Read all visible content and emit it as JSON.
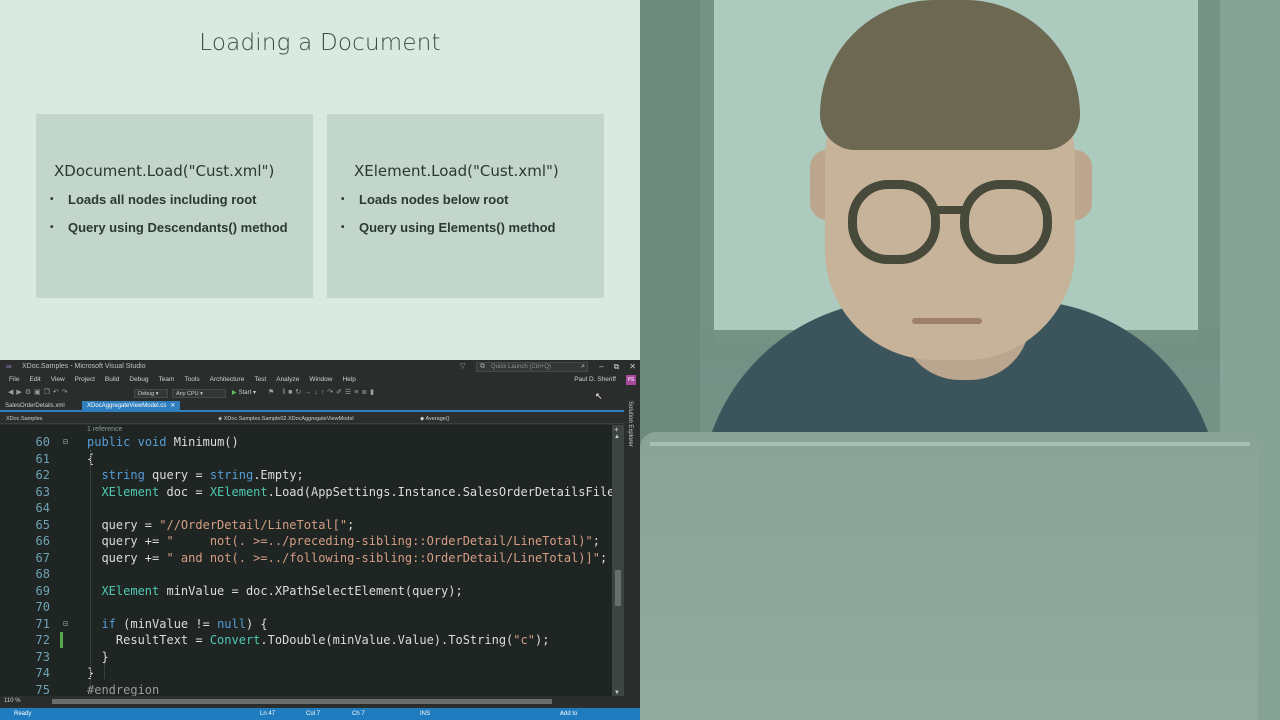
{
  "slide": {
    "title": "Loading a Document",
    "cards": [
      {
        "heading": "XDocument.Load(\"Cust.xml\")",
        "bullets": [
          "Loads all nodes including root",
          "Query using Descendants() method"
        ]
      },
      {
        "heading": "XElement.Load(\"Cust.xml\")",
        "bullets": [
          "Loads nodes below root",
          "Query using Elements() method"
        ]
      }
    ]
  },
  "ide": {
    "window_title": "XDoc.Samples - Microsoft Visual Studio",
    "quick_launch_placeholder": "Quick Launch (Ctrl+Q)",
    "menu": [
      "File",
      "Edit",
      "View",
      "Project",
      "Build",
      "Debug",
      "Team",
      "Tools",
      "Architecture",
      "Test",
      "Analyze",
      "Window",
      "Help"
    ],
    "user_name": "Paul D. Sheriff",
    "user_initials": "PS",
    "toolbar": {
      "config": "Debug",
      "platform": "Any CPU",
      "start_label": "Start"
    },
    "tabs": [
      {
        "label": "SalesOrderDetails.xml",
        "active": false
      },
      {
        "label": "XDocAggregateViewModel.cs",
        "active": true
      }
    ],
    "navbar": {
      "project": "XDoc.Samples",
      "class": "XDoc.Samples.Sample02.XDocAggregateViewModel",
      "member": "Average()"
    },
    "reference_note": "1 reference",
    "code_lines": [
      {
        "num": "60",
        "text": "public void Minimum()"
      },
      {
        "num": "61",
        "text": "{"
      },
      {
        "num": "62",
        "text": "  string query = string.Empty;"
      },
      {
        "num": "63",
        "text": "  XElement doc = XElement.Load(AppSettings.Instance.SalesOrderDetailsFile"
      },
      {
        "num": "64",
        "text": ""
      },
      {
        "num": "65",
        "text": "  query = \"//OrderDetail/LineTotal[\";"
      },
      {
        "num": "66",
        "text": "  query += \"     not(. >=../preceding-sibling::OrderDetail/LineTotal)\";"
      },
      {
        "num": "67",
        "text": "  query += \" and not(. >=../following-sibling::OrderDetail/LineTotal)]\";"
      },
      {
        "num": "68",
        "text": ""
      },
      {
        "num": "69",
        "text": "  XElement minValue = doc.XPathSelectElement(query);"
      },
      {
        "num": "70",
        "text": ""
      },
      {
        "num": "71",
        "text": "  if (minValue != null) {"
      },
      {
        "num": "72",
        "text": "    ResultText = Convert.ToDouble(minValue.Value).ToString(\"c\");"
      },
      {
        "num": "73",
        "text": "  }"
      },
      {
        "num": "74",
        "text": "}"
      },
      {
        "num": "75",
        "text": "#endregion"
      }
    ],
    "zoom": "110 %",
    "side_panel_label": "Solution Explorer",
    "status": {
      "ready": "Ready",
      "ln": "Ln 47",
      "col": "Col 7",
      "ch": "Ch 7",
      "ins": "INS",
      "source_control": "Add to Source Control"
    },
    "colors": {
      "accent": "#1f7cbf",
      "keyword": "#569cd6",
      "type": "#4ec9b0",
      "string": "#d69d85"
    }
  }
}
